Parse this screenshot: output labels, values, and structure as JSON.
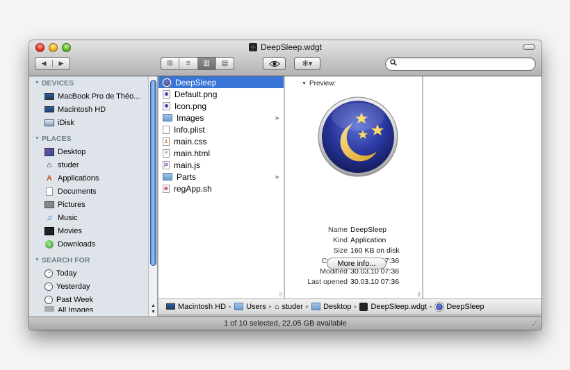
{
  "window": {
    "title": "DeepSleep.wdgt"
  },
  "toolbar": {
    "back_icon": "◀",
    "forward_icon": "▶",
    "views": [
      "⊞",
      "≡",
      "▥",
      "▤"
    ],
    "active_view": 2,
    "quicklook_icon": "👁",
    "action_icon": "✻▾",
    "search_placeholder": "",
    "search_value": ""
  },
  "sidebar": {
    "sections": [
      {
        "label": "DEVICES",
        "items": [
          {
            "label": "MacBook Pro de Théo...",
            "icon": "laptop-icon"
          },
          {
            "label": "Macintosh HD",
            "icon": "hard-disk-icon"
          },
          {
            "label": "iDisk",
            "icon": "idisk-icon"
          }
        ]
      },
      {
        "label": "PLACES",
        "items": [
          {
            "label": "Desktop",
            "icon": "desktop-icon"
          },
          {
            "label": "studer",
            "icon": "home-icon"
          },
          {
            "label": "Applications",
            "icon": "applications-icon"
          },
          {
            "label": "Documents",
            "icon": "documents-icon"
          },
          {
            "label": "Pictures",
            "icon": "pictures-icon"
          },
          {
            "label": "Music",
            "icon": "music-icon"
          },
          {
            "label": "Movies",
            "icon": "movies-icon"
          },
          {
            "label": "Downloads",
            "icon": "downloads-icon"
          }
        ]
      },
      {
        "label": "SEARCH FOR",
        "items": [
          {
            "label": "Today",
            "icon": "clock-icon"
          },
          {
            "label": "Yesterday",
            "icon": "clock-icon"
          },
          {
            "label": "Past Week",
            "icon": "clock-icon"
          },
          {
            "label": "All Images",
            "icon": "images-icon"
          }
        ]
      }
    ]
  },
  "files": [
    {
      "name": "DeepSleep",
      "type": "app",
      "selected": true,
      "folder": false
    },
    {
      "name": "Default.png",
      "type": "png",
      "selected": false,
      "folder": false
    },
    {
      "name": "Icon.png",
      "type": "png",
      "selected": false,
      "folder": false
    },
    {
      "name": "Images",
      "type": "folder",
      "selected": false,
      "folder": true
    },
    {
      "name": "Info.plist",
      "type": "doc",
      "selected": false,
      "folder": false
    },
    {
      "name": "main.css",
      "type": "css",
      "selected": false,
      "folder": false
    },
    {
      "name": "main.html",
      "type": "html",
      "selected": false,
      "folder": false
    },
    {
      "name": "main.js",
      "type": "js",
      "selected": false,
      "folder": false
    },
    {
      "name": "Parts",
      "type": "folder",
      "selected": false,
      "folder": true
    },
    {
      "name": "regApp.sh",
      "type": "sh",
      "selected": false,
      "folder": false
    }
  ],
  "preview": {
    "label": "Preview:",
    "info": [
      {
        "key": "Name",
        "value": "DeepSleep"
      },
      {
        "key": "Kind",
        "value": "Application"
      },
      {
        "key": "Size",
        "value": "160 KB on disk"
      },
      {
        "key": "Created",
        "value": "30.03.10 07:36"
      },
      {
        "key": "Modified",
        "value": "30.03.10 07:36"
      },
      {
        "key": "Last opened",
        "value": "30.03.10 07:36"
      }
    ],
    "more_info_label": "More info..."
  },
  "pathbar": [
    {
      "label": "Macintosh HD",
      "icon": "hard-disk-icon"
    },
    {
      "label": "Users",
      "icon": "folder-icon"
    },
    {
      "label": "studer",
      "icon": "home-icon"
    },
    {
      "label": "Desktop",
      "icon": "folder-icon"
    },
    {
      "label": "DeepSleep.wdgt",
      "icon": "widget-icon"
    },
    {
      "label": "DeepSleep",
      "icon": "app-icon"
    }
  ],
  "status": "1 of 10 selected, 22.05 GB available",
  "colors": {
    "selection": "#3875d7",
    "sidebar_bg": "#dee4ea",
    "section_header": "#6f7c8a"
  }
}
